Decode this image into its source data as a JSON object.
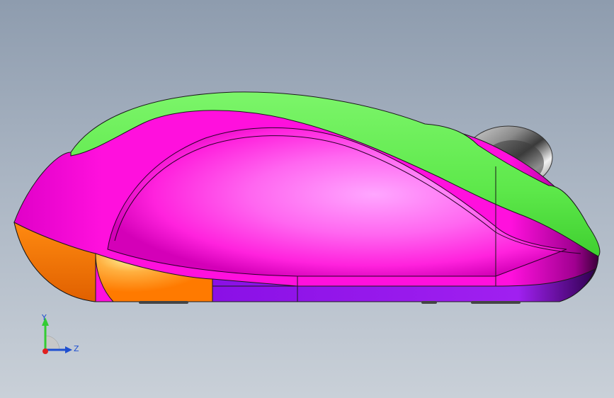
{
  "viewport": {
    "background_top": "#8e9cae",
    "background_bottom": "#c9d0d8"
  },
  "model": {
    "part_colors": {
      "top_shell": "#5de84a",
      "side_body": "#ff33e6",
      "side_highlight": "#ffa6ff",
      "front_bumper": "#ff7a00",
      "bottom_strip": "#8a10e6",
      "scroll_wheel": "#9a9a9a"
    }
  },
  "triad": {
    "y_label": "Y",
    "z_label": "Z",
    "y_color": "#33cc33",
    "z_color": "#1f4fd0",
    "x_color": "#e02020"
  }
}
